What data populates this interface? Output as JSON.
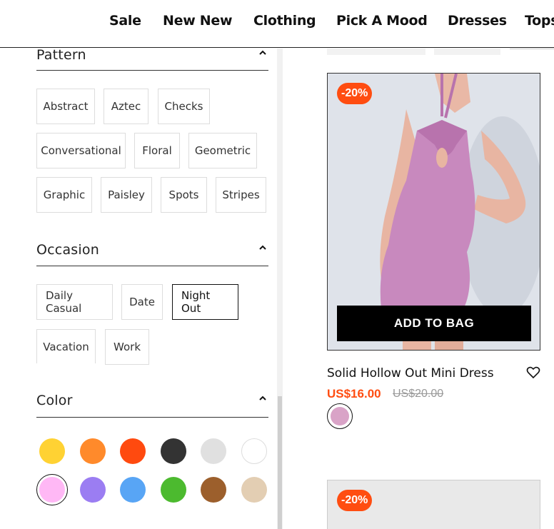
{
  "nav": {
    "items": [
      "Sale",
      "New New",
      "Clothing",
      "Pick A Mood",
      "Dresses",
      "Tops"
    ]
  },
  "filters": {
    "pattern": {
      "title": "Pattern",
      "options": [
        "Abstract",
        "Aztec",
        "Checks",
        "Conversational",
        "Floral",
        "Geometric",
        "Graphic",
        "Paisley",
        "Spots",
        "Stripes"
      ]
    },
    "occasion": {
      "title": "Occasion",
      "options": [
        "Daily Casual",
        "Date",
        "Night Out",
        "Vacation",
        "Work"
      ],
      "selected": "Night Out"
    },
    "color": {
      "title": "Color",
      "swatches": [
        "#ffd233",
        "#ff8a2b",
        "#ff4a0f",
        "#333333",
        "#e0e0e0",
        "#ffffff",
        "#ffb8f5",
        "#9b7df2",
        "#58a5f5",
        "#4cba2f",
        "#9c5f2c",
        "#e3ceb3"
      ],
      "selected_index": 6
    }
  },
  "products": [
    {
      "discount_badge": "-20%",
      "add_to_bag": "ADD TO BAG",
      "name": "Solid Hollow Out Mini Dress",
      "price": "US$16.00",
      "old_price": "US$20.00",
      "color_option": "#d9a3c7"
    },
    {
      "discount_badge": "-20%"
    }
  ],
  "colors": {
    "accent": "#ff4d11",
    "text": "#111111"
  }
}
